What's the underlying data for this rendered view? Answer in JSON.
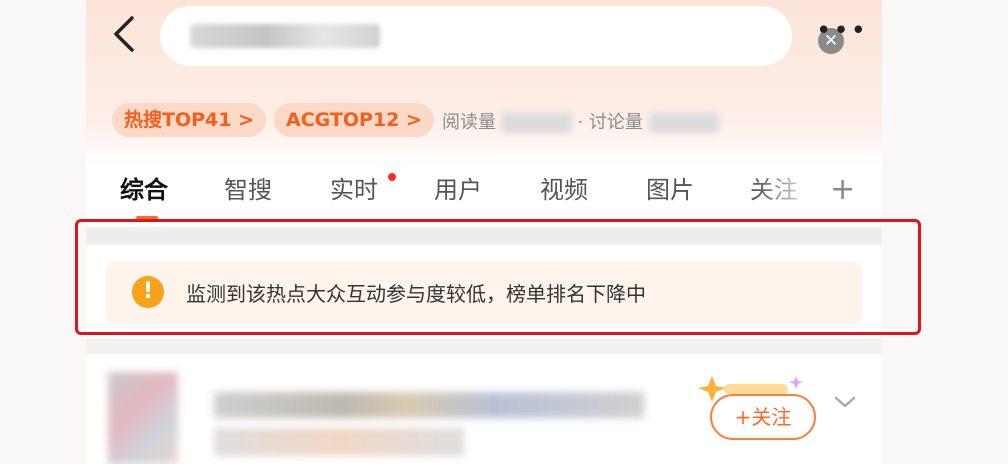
{
  "header": {
    "search_query": "",
    "clear_icon": "close-icon",
    "more_label": "•••"
  },
  "badges": {
    "hot": "热搜TOP41 >",
    "acg": "ACGTOP12 >"
  },
  "stats": {
    "read_label": "阅读量",
    "discuss_label": "· 讨论量"
  },
  "tabs": [
    {
      "label": "综合",
      "active": true
    },
    {
      "label": "智搜"
    },
    {
      "label": "实时",
      "badge_dot": true
    },
    {
      "label": "用户"
    },
    {
      "label": "视频"
    },
    {
      "label": "图片"
    },
    {
      "label": "关注"
    }
  ],
  "tabs_add": "+",
  "notice": {
    "icon": "warning-icon",
    "text": "监测到该热点大众互动参与度较低，榜单排名下降中"
  },
  "post": {
    "follow_label": "+关注"
  },
  "colors": {
    "accent": "#ff6a2b",
    "highlight_border": "#e0141e",
    "warning": "#f7a21b"
  }
}
